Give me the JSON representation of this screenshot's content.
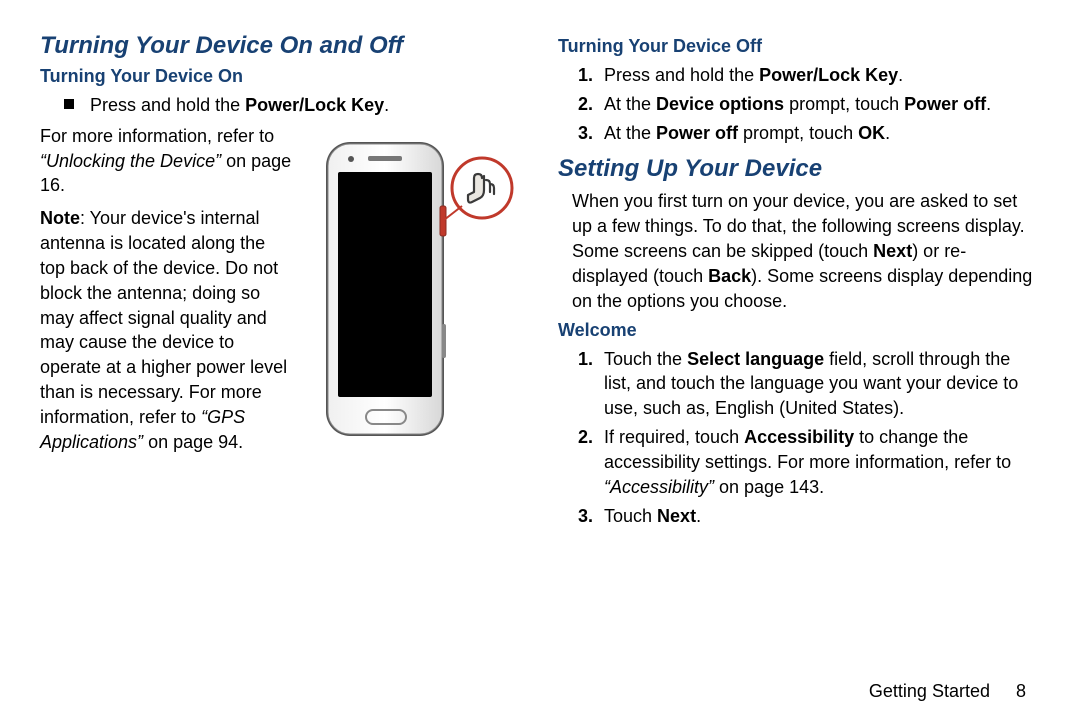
{
  "left": {
    "h1": "Turning Your Device On and Off",
    "h2": "Turning Your Device On",
    "bullet_pre": "Press and hold the ",
    "bullet_bold": "Power/Lock Key",
    "bullet_post": ".",
    "para1_pre": "For more information, refer to ",
    "para1_ital": "“Unlocking the Device”",
    "para1_post": " on page 16.",
    "note_label": "Note",
    "note_pre": ": Your device's internal antenna is located along the top back of the device. Do not block the antenna; doing so may affect signal quality and may cause the device to operate at a higher power level than is necessary. For more information, refer to ",
    "note_ital": "“GPS Applications”",
    "note_post": " on page 94."
  },
  "rightA": {
    "h2": "Turning Your Device Off",
    "s1_pre": "Press and hold the ",
    "s1_b": "Power/Lock Key",
    "s1_post": ".",
    "s2_a": "At the ",
    "s2_b1": "Device options",
    "s2_c": " prompt, touch ",
    "s2_b2": "Power off",
    "s2_d": ".",
    "s3_a": "At the ",
    "s3_b1": "Power off",
    "s3_c": " prompt, touch ",
    "s3_b2": "OK",
    "s3_d": "."
  },
  "rightB": {
    "h1": "Setting Up Your Device",
    "intro_a": "When you first turn on your device, you are asked to set up a few things. To do that, the following screens display. Some screens can be skipped (touch ",
    "intro_b1": "Next",
    "intro_b": ") or re-displayed (touch ",
    "intro_b2": "Back",
    "intro_c": "). Some screens display depending on the options you choose.",
    "h2": "Welcome",
    "w1_a": "Touch the ",
    "w1_b": "Select language",
    "w1_c": " field, scroll through the list, and touch the language you want your device to use, such as, English (United States).",
    "w2_a": "If required, touch ",
    "w2_b": "Accessibility",
    "w2_c": " to change the accessibility settings. For more information, refer to ",
    "w2_i": "“Accessibility”",
    "w2_d": " on page 143.",
    "w3_a": "Touch ",
    "w3_b": "Next",
    "w3_c": "."
  },
  "footer": {
    "section": "Getting Started",
    "page": "8"
  },
  "steps": {
    "n1": "1.",
    "n2": "2.",
    "n3": "3."
  }
}
